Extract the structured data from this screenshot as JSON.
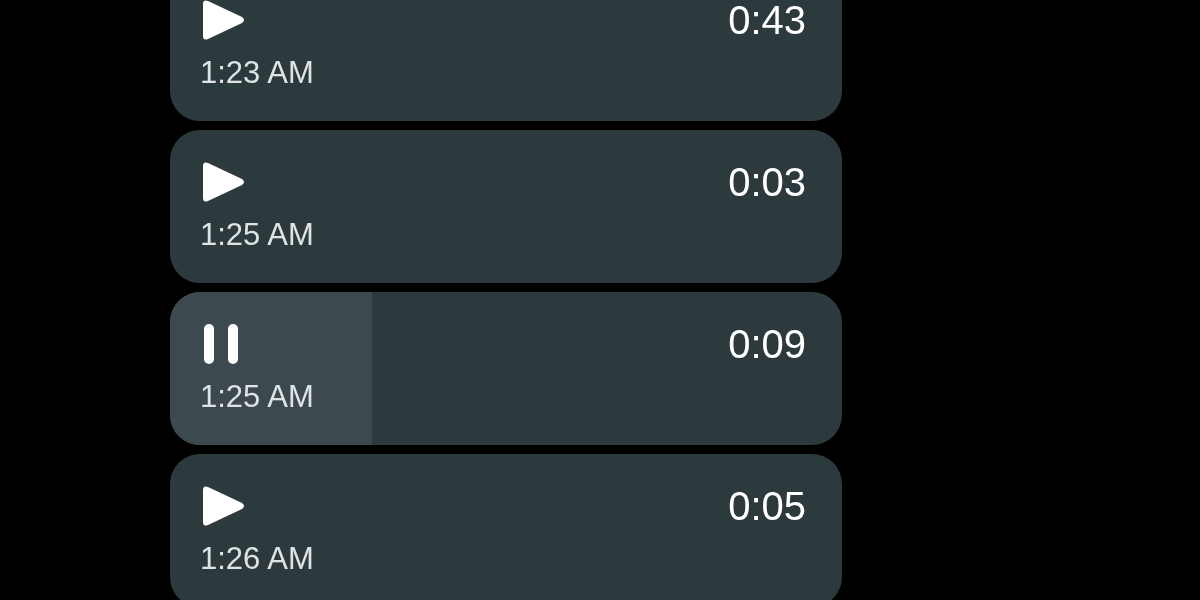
{
  "recordings": [
    {
      "playing": false,
      "duration": "0:43",
      "time": "1:23 AM"
    },
    {
      "playing": false,
      "duration": "0:03",
      "time": "1:25 AM"
    },
    {
      "playing": true,
      "level": 0.3,
      "duration": "0:09",
      "time": "1:25 AM"
    },
    {
      "playing": false,
      "duration": "0:05",
      "time": "1:26 AM"
    }
  ]
}
